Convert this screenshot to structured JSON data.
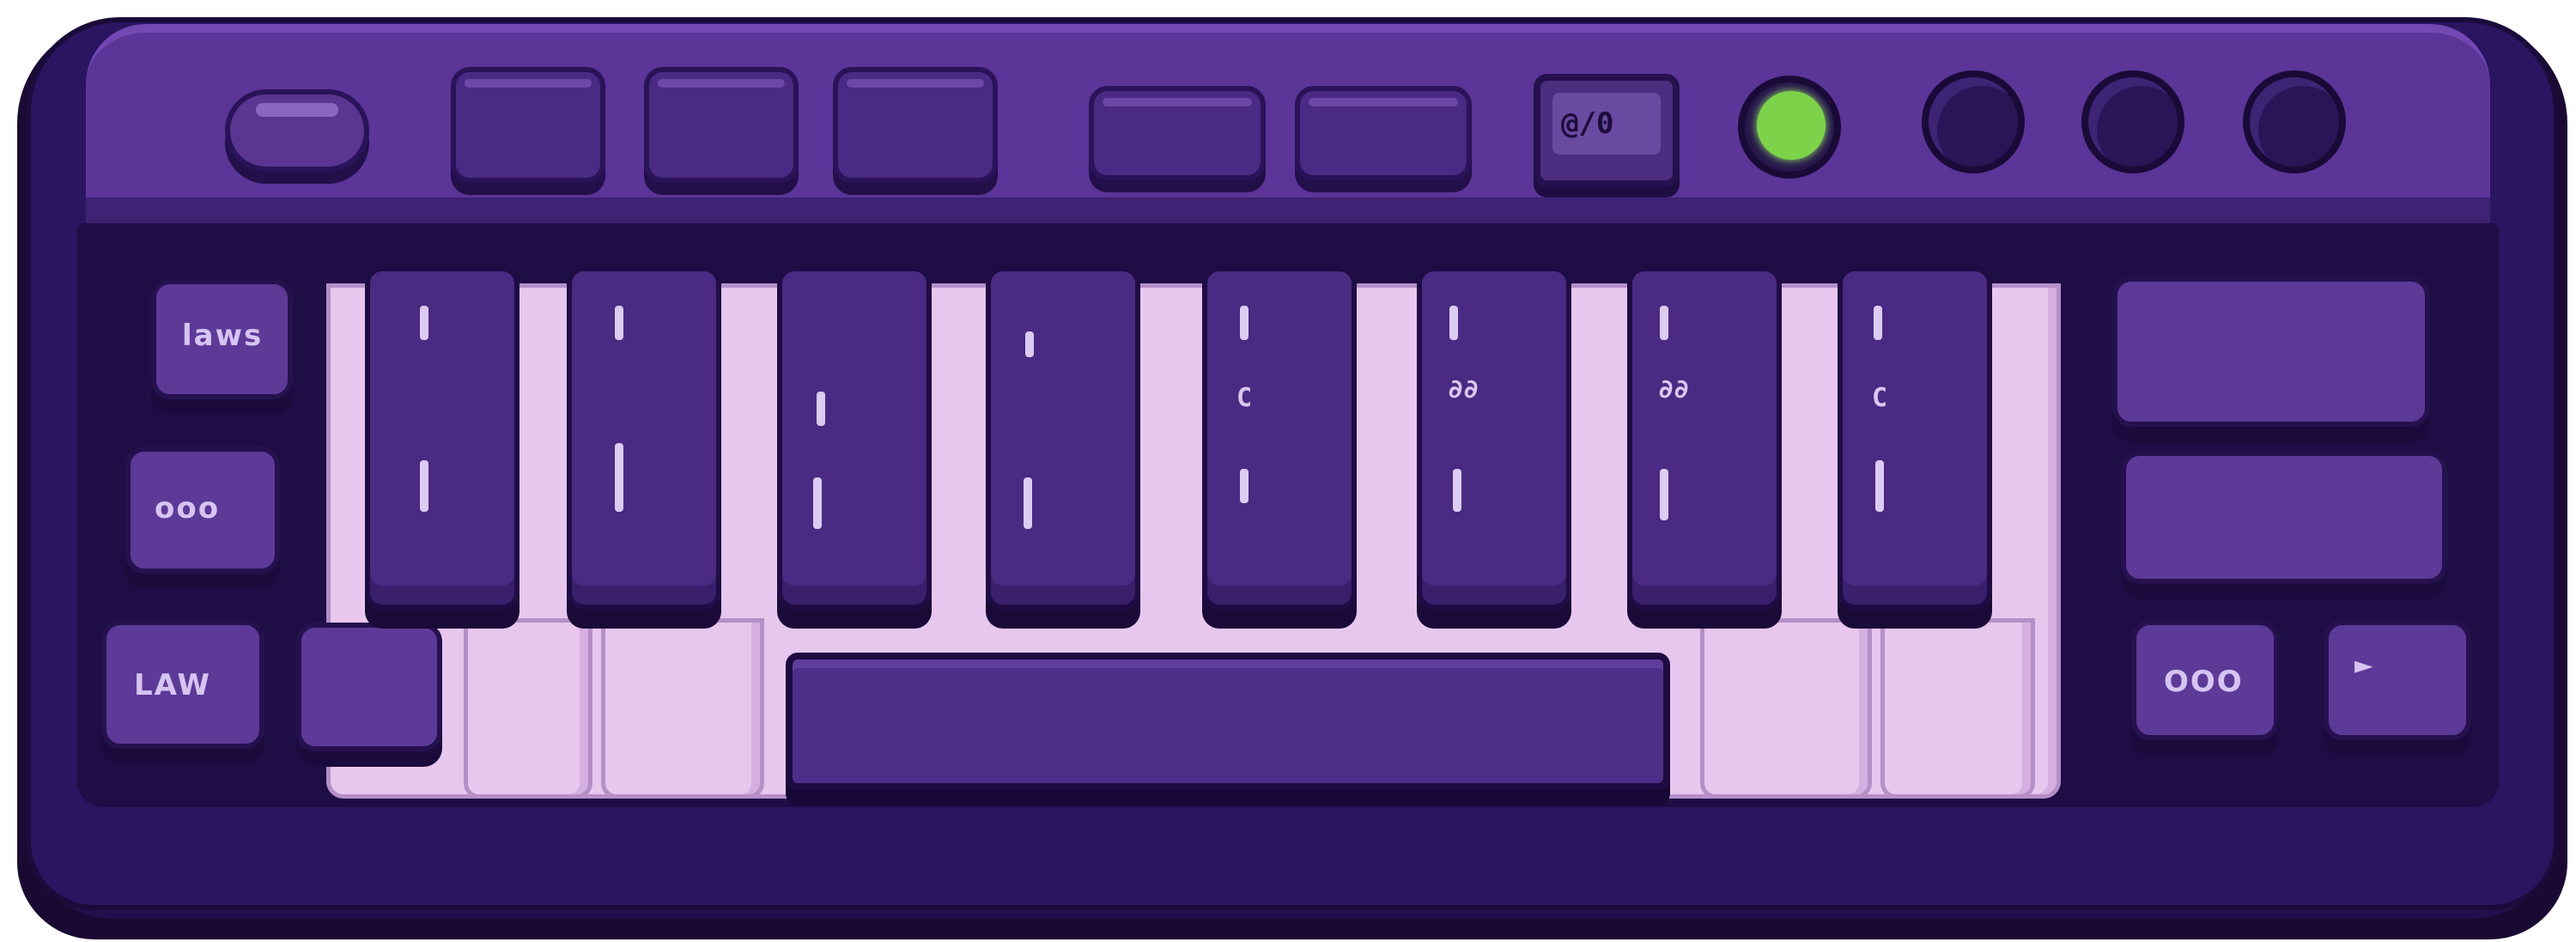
{
  "colors": {
    "body": "#2b1560",
    "panel": "#5b3598",
    "white_keys": "#e7c7ee",
    "black_keys": "#4a2a82",
    "led_green": "#7cd34a"
  },
  "device": {
    "lcd_text": "@/0",
    "side_keys": [
      {
        "label": "laws"
      },
      {
        "label": "ooo"
      },
      {
        "label": "LAW"
      }
    ],
    "right_keys": [
      {
        "label": ""
      },
      {
        "label": ""
      },
      {
        "label": "OOO"
      },
      {
        "label": "►"
      }
    ],
    "black_key_labels": [
      {
        "label": ""
      },
      {
        "label": ""
      },
      {
        "label": ""
      },
      {
        "label": ""
      },
      {
        "label": "C"
      },
      {
        "label": "∂∂"
      },
      {
        "label": "∂∂"
      },
      {
        "label": "C"
      }
    ]
  }
}
